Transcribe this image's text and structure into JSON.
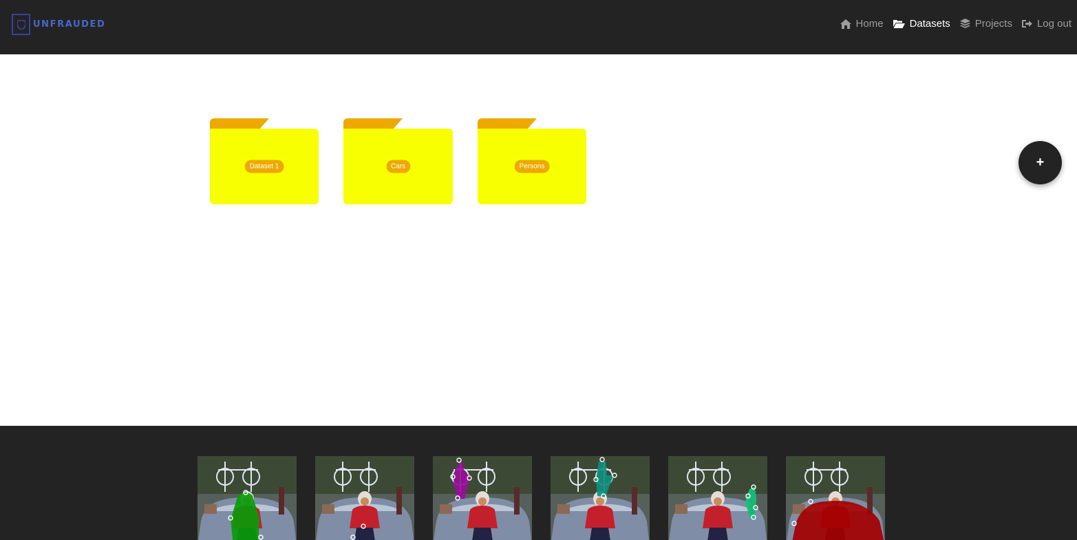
{
  "header": {
    "logo_text": "UNFRAUDED",
    "nav": [
      {
        "label": "Home",
        "icon": "home-icon",
        "active": false
      },
      {
        "label": "Datasets",
        "icon": "folder-open-icon",
        "active": true
      },
      {
        "label": "Projects",
        "icon": "layers-icon",
        "active": false
      },
      {
        "label": "Log out",
        "icon": "logout-icon",
        "active": false
      }
    ]
  },
  "folders": [
    {
      "label": "Dataset 1"
    },
    {
      "label": "Cars"
    },
    {
      "label": "Persons"
    }
  ],
  "fab": {
    "label": "+"
  },
  "colors": {
    "navbar": "#232323",
    "folder_body": "#f8ff00",
    "folder_tab": "#eda900",
    "nav_active": "#ffffff",
    "nav_inactive": "#9d9d9d"
  },
  "thumbnails": [
    {
      "overlay": "green-mask",
      "color": "#0a9a0a"
    },
    {
      "overlay": "none",
      "color": ""
    },
    {
      "overlay": "purple-mask",
      "color": "#9a0e9a"
    },
    {
      "overlay": "teal-mask",
      "color": "#0e8f7e"
    },
    {
      "overlay": "mint-mask",
      "color": "#14c27a"
    },
    {
      "overlay": "red-mask",
      "color": "#a30000"
    }
  ]
}
